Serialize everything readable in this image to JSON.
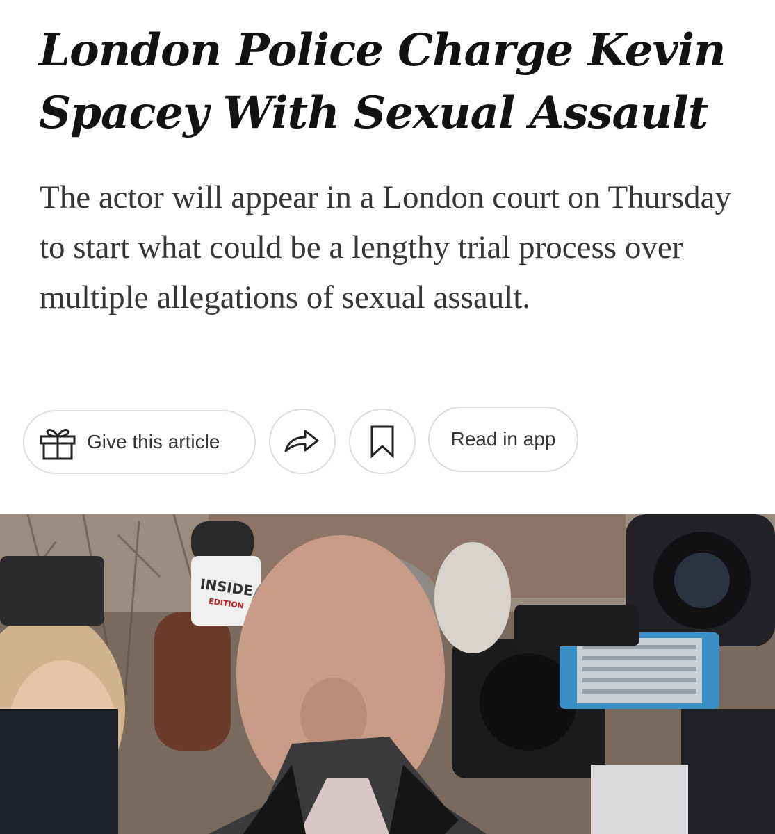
{
  "article": {
    "headline": "London Police Charge Kevin Spacey With Sexual Assault",
    "dek": "The actor will appear in a London court on Thursday to start what could be a lengthy trial process over multiple allegations of sexual assault."
  },
  "actions": {
    "gift_label": "Give this article",
    "share_icon": "share-arrow-icon",
    "save_icon": "bookmark-icon",
    "app_label": "Read in app"
  },
  "photo": {
    "microphone_text_1": "INSIDE",
    "microphone_text_2": "EDITION"
  },
  "colors": {
    "headline": "#121212",
    "dek": "#363636",
    "pill_border": "#dcdcdc"
  }
}
